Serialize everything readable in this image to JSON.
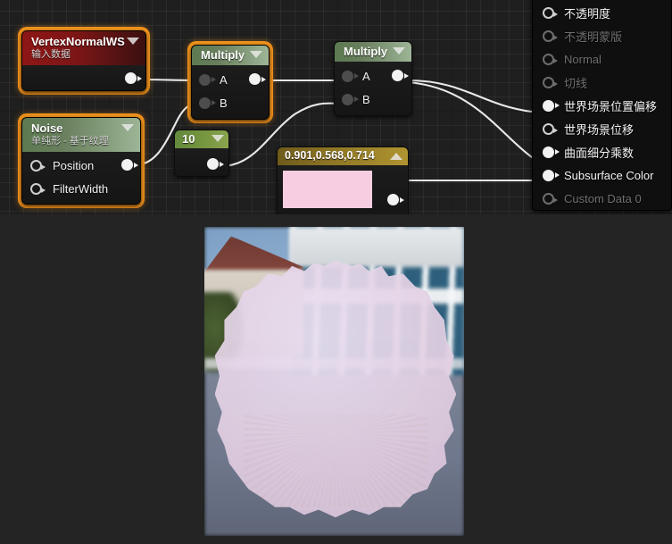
{
  "editor": {
    "name": "material-graph-editor",
    "background_color": "#1f1f1f",
    "selection_color": "#f0921d"
  },
  "nodes": [
    {
      "id": "vertex-normal-ws",
      "title": "VertexNormalWS",
      "subtitle": "输入数据",
      "header_color": "#8e1616",
      "selected": true,
      "inputs": [],
      "outputs": [
        {
          "label": "",
          "connected": true
        }
      ]
    },
    {
      "id": "noise",
      "title": "Noise",
      "subtitle": "单纯形 - 基于纹理",
      "header_color": "#5c7a52",
      "selected": true,
      "inputs": [
        {
          "label": "Position",
          "connected": false
        },
        {
          "label": "FilterWidth",
          "connected": false
        }
      ],
      "outputs": [
        {
          "label": "",
          "connected": true
        }
      ]
    },
    {
      "id": "multiply-1",
      "title": "Multiply",
      "subtitle": "",
      "header_color": "#697f5d",
      "selected": true,
      "inputs": [
        {
          "label": "A",
          "connected": true
        },
        {
          "label": "B",
          "connected": true
        }
      ],
      "outputs": [
        {
          "label": "",
          "connected": true
        }
      ]
    },
    {
      "id": "multiply-2",
      "title": "Multiply",
      "subtitle": "",
      "header_color": "#697f5d",
      "selected": false,
      "inputs": [
        {
          "label": "A",
          "connected": true
        },
        {
          "label": "B",
          "connected": true
        }
      ],
      "outputs": [
        {
          "label": "",
          "connected": true
        }
      ]
    },
    {
      "id": "constant-10",
      "title": "10",
      "subtitle": "",
      "header_color": "#76963f",
      "selected": false,
      "inputs": [],
      "outputs": [
        {
          "label": "",
          "connected": true
        }
      ]
    },
    {
      "id": "constant3vector",
      "title": "0.901,0.568,0.714",
      "subtitle": "",
      "header_color": "#8d7524",
      "selected": false,
      "swatch_color": "#f6cde1",
      "collapse_caret": "up",
      "inputs": [],
      "outputs": [
        {
          "label": "",
          "connected": true
        }
      ]
    }
  ],
  "material_output": {
    "name": "material-output-node",
    "pins": [
      {
        "label": "不透明度",
        "connected": false,
        "enabled": true
      },
      {
        "label": "不透明蒙版",
        "connected": false,
        "enabled": false
      },
      {
        "label": "Normal",
        "connected": false,
        "enabled": false
      },
      {
        "label": "切线",
        "connected": false,
        "enabled": false
      },
      {
        "label": "世界场景位置偏移",
        "connected": true,
        "enabled": true
      },
      {
        "label": "世界场景位移",
        "connected": false,
        "enabled": true
      },
      {
        "label": "曲面细分乘数",
        "connected": true,
        "enabled": true
      },
      {
        "label": "Subsurface Color",
        "connected": true,
        "enabled": true
      },
      {
        "label": "Custom Data 0",
        "connected": false,
        "enabled": false
      }
    ]
  },
  "preview": {
    "name": "material-preview-viewport",
    "sphere_color": "#e3d0e4",
    "background_description": "blurred office building and sky"
  }
}
